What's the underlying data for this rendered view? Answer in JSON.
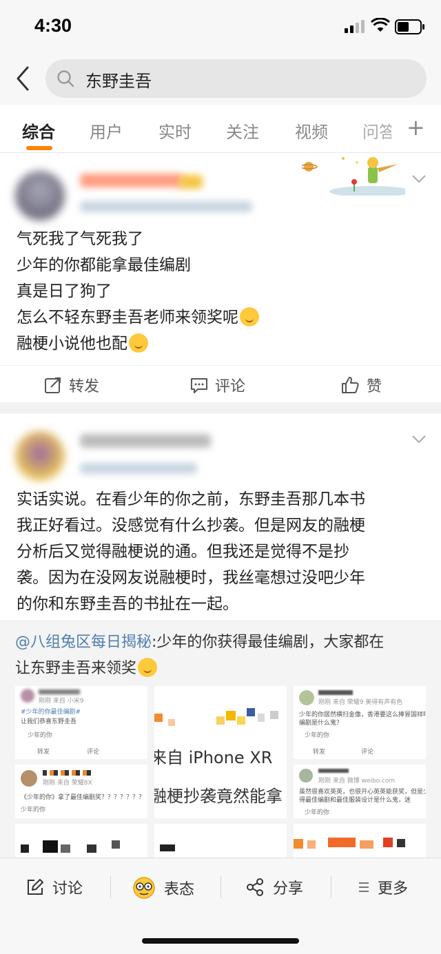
{
  "status_bar": {
    "time": "4:30"
  },
  "search": {
    "query": "东野圭吾"
  },
  "tabs": [
    {
      "label": "综合"
    },
    {
      "label": "用户"
    },
    {
      "label": "实时"
    },
    {
      "label": "关注"
    },
    {
      "label": "视频"
    },
    {
      "label": "问答"
    }
  ],
  "post1": {
    "lines": [
      "气死我了气死我了",
      "少年的你都能拿最佳编剧",
      "真是日了狗了",
      "怎么不轻东野圭吾老师来领奖呢",
      "融梗小说他也配"
    ],
    "actions": {
      "repost": "转发",
      "comment": "评论",
      "like": "赞"
    }
  },
  "post2": {
    "lines": [
      "实话实说。在看少年的你之前，东野圭吾那几本书",
      "我正好看过。没感觉有什么抄袭。但是网友的融梗",
      "分析后又觉得融梗说的通。但我还是觉得不是抄",
      "袭。因为在没网友说融梗时，我丝毫想过没吧少年",
      "的你和东野圭吾的书扯在一起。"
    ],
    "repost": {
      "author": "@八组兔区每日揭秘",
      "text_line1": ":少年的你获得最佳编剧，大家都在",
      "text_line2": "让东野圭吾来领奖"
    },
    "thumbs": {
      "t1_source": "刚刚  来自 小米9",
      "t1_tag": "#少年的你最佳编剧#",
      "t1_text": "让我们恭喜东野圭吾",
      "t1_from": "少年的你",
      "t1_repost": "转发",
      "t1_comment": "评论",
      "t2_source": "刚刚  来自 荣耀8X",
      "t2_text": "《少年的你》拿了最佳编剧奖？？？？？？？",
      "t2_from": "少年的你",
      "t3_big1": "来自 iPhone XR",
      "t3_big2": "融梗抄袭竟然能拿",
      "t4_source": "刚刚  来自 荣耀9 美得有声有色",
      "t4_text1": "少年的你居然横扫金像，香港要这么捧冒国祥吗？最佳",
      "t4_text2": "编剧是什么鬼？",
      "t4_from": "少年的你",
      "t4_repost": "转发",
      "t4_comment": "评论",
      "t5_source": "刚刚  来自 微博 weibo.com",
      "t5_text1": "虽然很喜欢英英，也很开心英英能获奖，但是少年的你",
      "t5_text2": "得最佳编剧和最佳服装设计是什么鬼，迷",
      "t5_from": "少年的你"
    }
  },
  "bottom_bar": {
    "discuss": "讨论",
    "attitude": "表态",
    "share": "分享",
    "more": "更多"
  }
}
